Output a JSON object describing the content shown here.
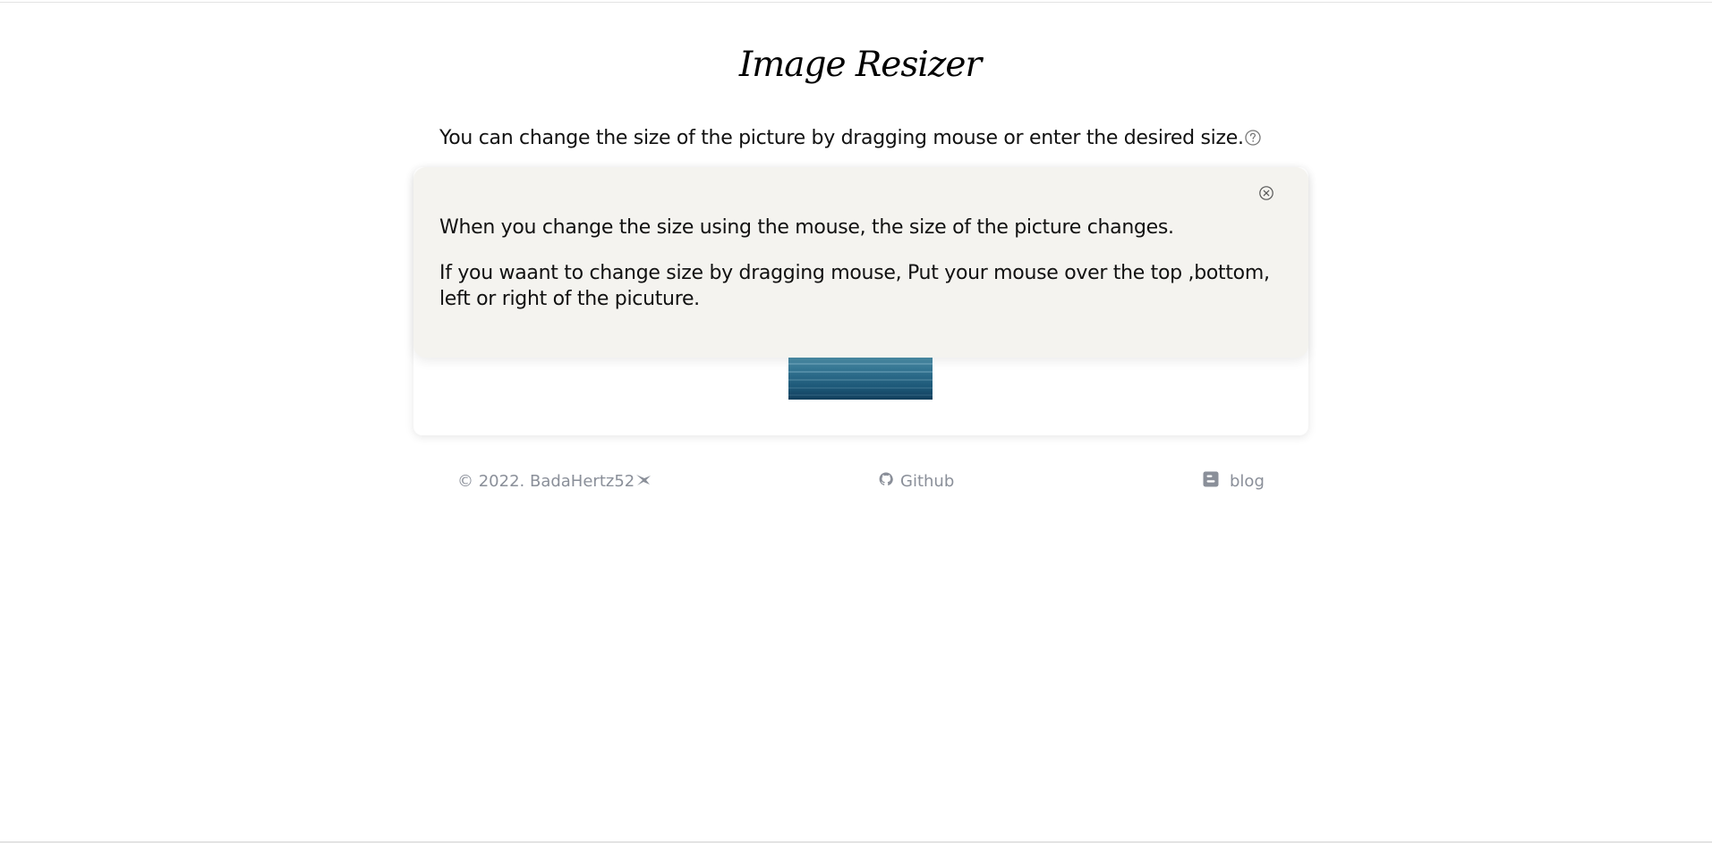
{
  "header": {
    "title": "Image Resizer"
  },
  "instruction": {
    "text": "You can change the size of the picture by dragging mouse or enter the desired size.",
    "help_icon": "question-circle-icon"
  },
  "tooltip": {
    "close_icon": "close-circle-icon",
    "paragraph_1": "When you change the size using the mouse, the size of the picture changes.",
    "paragraph_2": "If you waant to change size by dragging mouse, Put your mouse over the top ,bottom, left or right of the picuture.",
    "background_color": "#f4f3ef"
  },
  "preview": {
    "image": "sea-water-thumbnail"
  },
  "footer": {
    "copyright": "© 2022. BadaHertz52",
    "copyright_icon": "bird-icon",
    "github_label": "Github",
    "github_icon": "github-icon",
    "blog_label": "blog",
    "blog_icon": "blogger-icon",
    "text_color": "#8a8f99"
  }
}
